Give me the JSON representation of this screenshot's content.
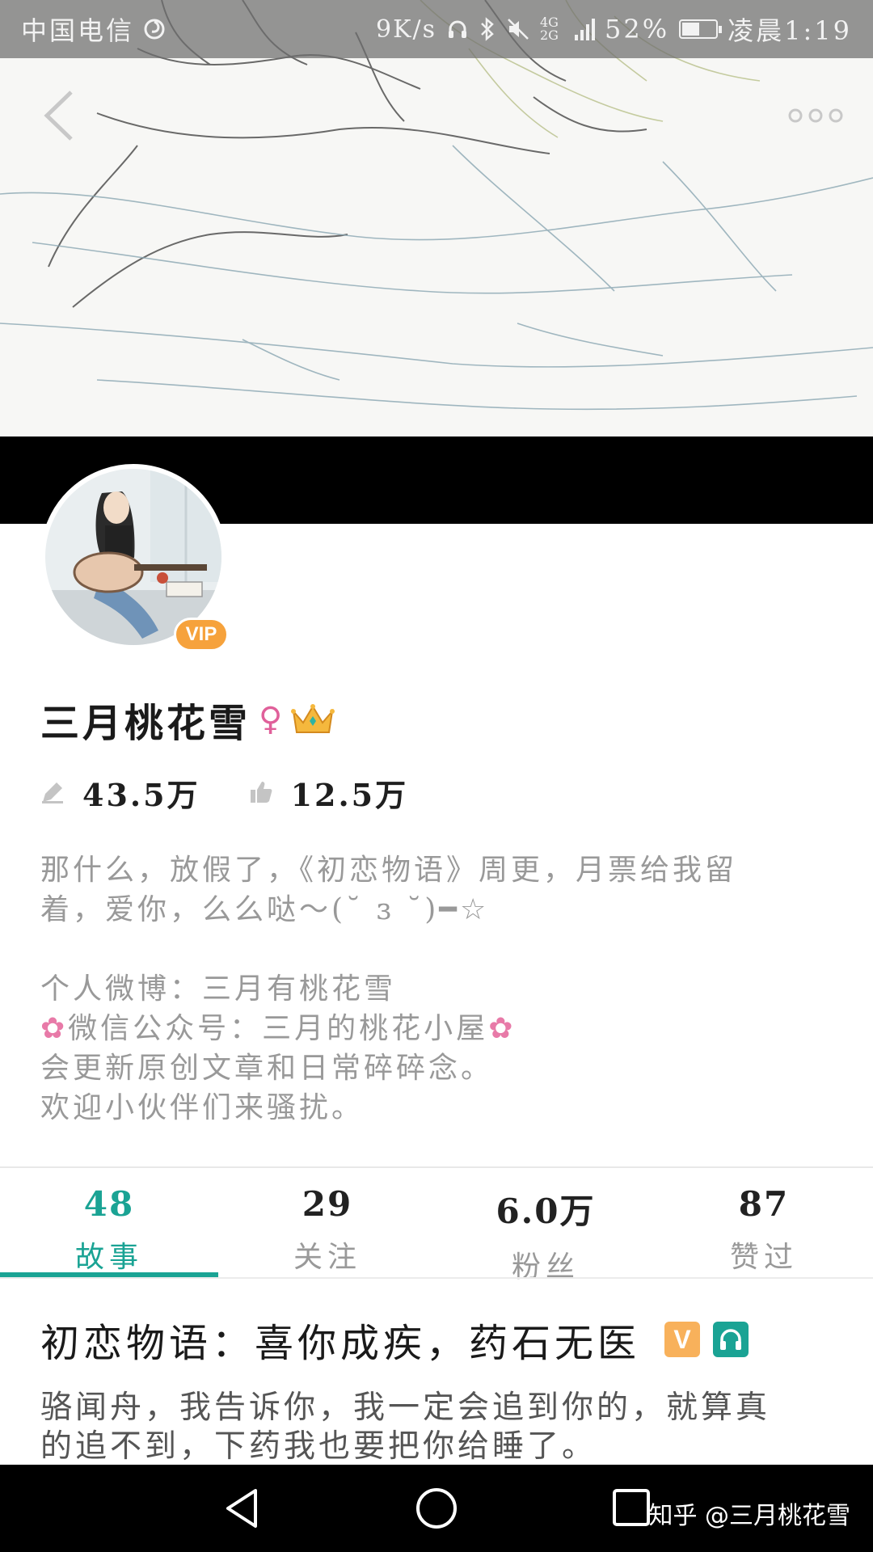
{
  "status_bar": {
    "carrier": "中国电信",
    "net_speed": "9K/s",
    "network_type": "4G 2G",
    "battery": "52%",
    "battery_level": 0.52,
    "time": "凌晨1:19"
  },
  "profile": {
    "vip_badge": "VIP",
    "name": "三月桃花雪",
    "gender_symbol": "♀",
    "stats": [
      {
        "icon": "pen-icon",
        "value": "43.5万"
      },
      {
        "icon": "thumbs-up-icon",
        "value": "12.5万"
      }
    ],
    "bio_lines": [
      "那什么，放假了，《初恋物语》周更，月票给我留",
      "着，爱你，么么哒～(˘ ɜ ˘)━☆",
      "",
      "个人微博：三月有桃花雪",
      "微信公众号：三月的桃花小屋",
      "会更新原创文章和日常碎碎念。",
      "欢迎小伙伴们来骚扰。"
    ],
    "flower_glyph": "✿"
  },
  "tabs": [
    {
      "count": "48",
      "label": "故事",
      "active": true
    },
    {
      "count": "29",
      "label": "关注",
      "active": false
    },
    {
      "count": "6.0万",
      "label": "粉丝",
      "active": false
    },
    {
      "count": "87",
      "label": "赞过",
      "active": false
    }
  ],
  "story": {
    "title": "初恋物语：喜你成疾，药石无医",
    "tag_v": "V",
    "excerpt_lines": [
      "骆闻舟，我告诉你，我一定会追到你的，就算真",
      "的追不到，下药我也要把你给睡了。"
    ]
  },
  "watermark": "知乎 @三月桃花雪",
  "colors": {
    "accent": "#1aa394",
    "vip": "#f6a23c",
    "gender": "#e0609a"
  }
}
